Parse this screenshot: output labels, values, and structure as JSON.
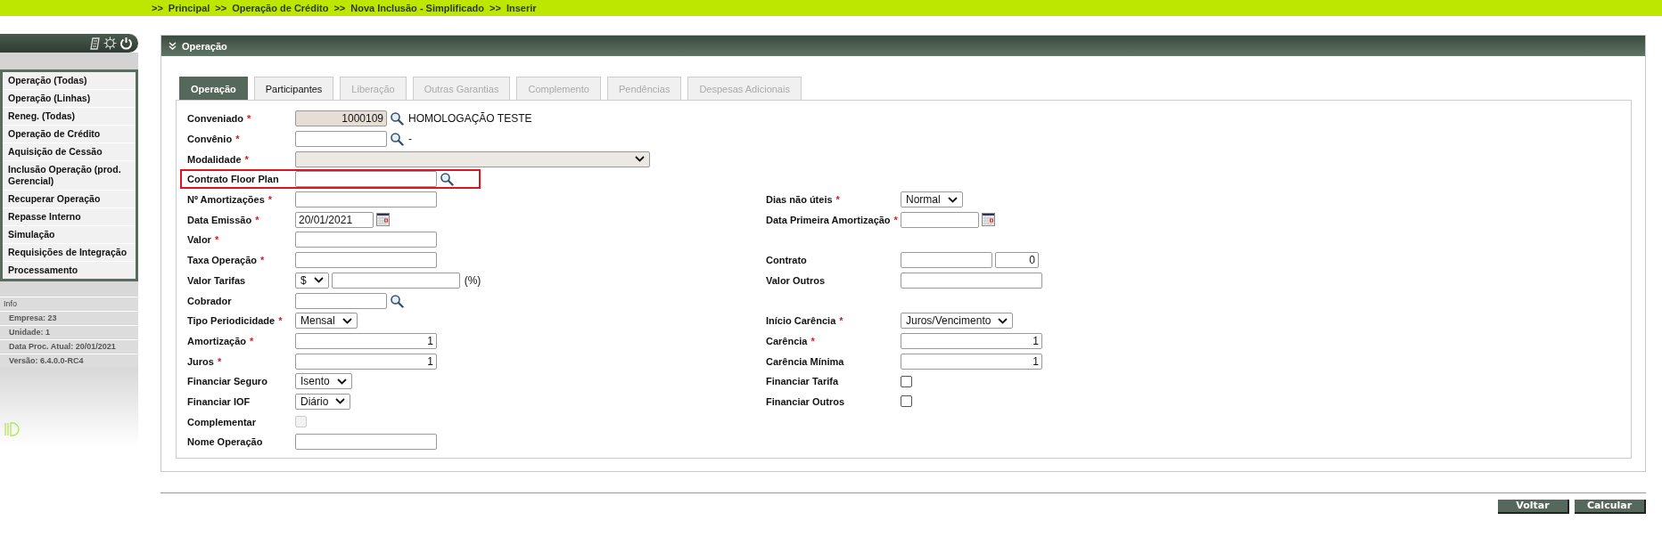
{
  "breadcrumb": [
    {
      "separator": ">>",
      "label": "Principal"
    },
    {
      "separator": ">>",
      "label": "Operação de Crédito"
    },
    {
      "separator": ">>",
      "label": "Nova Inclusão - Simplificado"
    },
    {
      "separator": ">>",
      "label": "Inserir"
    }
  ],
  "sidebar": {
    "menu": [
      "Operação (Todas)",
      "Operação (Linhas)",
      "Reneg. (Todas)",
      "Operação de Crédito",
      "Aquisição de Cessão",
      "Inclusão Operação (prod. Gerencial)",
      "Recuperar Operação",
      "Repasse Interno",
      "Simulação",
      "Requisições de Integração",
      "Processamento"
    ],
    "info_title": "Info",
    "info": [
      "Empresa: 23",
      "Unidade: 1",
      "Data Proc. Atual: 20/01/2021",
      "Versão: 6.4.0.0-RC4"
    ]
  },
  "panel": {
    "title": "Operação"
  },
  "tabs": [
    {
      "label": "Operação",
      "selected": true,
      "disabled": false
    },
    {
      "label": "Participantes",
      "selected": false,
      "disabled": false
    },
    {
      "label": "Liberação",
      "selected": false,
      "disabled": true
    },
    {
      "label": "Outras Garantias",
      "selected": false,
      "disabled": true
    },
    {
      "label": "Complemento",
      "selected": false,
      "disabled": true
    },
    {
      "label": "Pendências",
      "selected": false,
      "disabled": true
    },
    {
      "label": "Despesas Adicionais",
      "selected": false,
      "disabled": true
    }
  ],
  "rows": [
    {
      "left": {
        "label": "Conveniado",
        "required_mark": "*",
        "controls": [
          {
            "kind": "code_input",
            "value": "1000109",
            "readonly": true
          },
          {
            "kind": "search_icon"
          },
          {
            "kind": "text",
            "text": "HOMOLOGAÇÃO TESTE"
          }
        ]
      }
    },
    {
      "left": {
        "label": "Convênio",
        "required_mark": "*",
        "controls": [
          {
            "kind": "code_input"
          },
          {
            "kind": "search_icon"
          },
          {
            "kind": "text",
            "text": "-"
          }
        ]
      }
    },
    {
      "left": {
        "label": "Modalidade",
        "required_mark": "*",
        "controls": [
          {
            "kind": "wide_select",
            "disabled": true
          }
        ]
      }
    },
    {
      "left": {
        "label": "Contrato Floor Plan",
        "highlighted": true,
        "controls": [
          {
            "kind": "input"
          },
          {
            "kind": "search_icon"
          }
        ]
      }
    },
    {
      "left": {
        "label": "Nº Amortizações",
        "required_mark": "*",
        "controls": [
          {
            "kind": "input"
          }
        ]
      },
      "right": {
        "label": "Dias não úteis",
        "required_mark": "*",
        "controls": [
          {
            "kind": "select",
            "value": "Normal"
          }
        ]
      }
    },
    {
      "left": {
        "label": "Data Emissão",
        "required_mark": "*",
        "controls": [
          {
            "kind": "date_input",
            "value": "20/01/2021"
          },
          {
            "kind": "calendar_icon"
          }
        ]
      },
      "right": {
        "label": "Data Primeira Amortização",
        "required_mark": "*",
        "controls": [
          {
            "kind": "date_input"
          },
          {
            "kind": "calendar_icon"
          }
        ]
      }
    },
    {
      "left": {
        "label": "Valor",
        "required_mark": "*",
        "controls": [
          {
            "kind": "input"
          }
        ]
      }
    },
    {
      "left": {
        "label": "Taxa Operação",
        "required_mark": "*",
        "controls": [
          {
            "kind": "input"
          }
        ]
      },
      "right": {
        "label": "Contrato",
        "controls": [
          {
            "kind": "code_input"
          },
          {
            "kind": "tiny_input",
            "value": "0"
          }
        ]
      }
    },
    {
      "left": {
        "label": "Valor Tarifas",
        "controls": [
          {
            "kind": "select",
            "value": "$"
          },
          {
            "kind": "long_input"
          },
          {
            "kind": "text",
            "text": "(%)"
          }
        ]
      },
      "right": {
        "label": "Valor Outros",
        "controls": [
          {
            "kind": "input"
          }
        ]
      }
    },
    {
      "left": {
        "label": "Cobrador",
        "controls": [
          {
            "kind": "code_input"
          },
          {
            "kind": "search_icon"
          }
        ]
      }
    },
    {
      "left": {
        "label": "Tipo Periodicidade",
        "required_mark": "*",
        "controls": [
          {
            "kind": "select",
            "value": "Mensal"
          }
        ]
      },
      "right": {
        "label": "Início Carência",
        "required_mark": "*",
        "controls": [
          {
            "kind": "select",
            "value": "Juros/Vencimento"
          }
        ]
      }
    },
    {
      "left": {
        "label": "Amortização",
        "required_mark": "*",
        "controls": [
          {
            "kind": "number_input",
            "value": "1"
          }
        ]
      },
      "right": {
        "label": "Carência",
        "required_mark": "*",
        "controls": [
          {
            "kind": "number_input",
            "value": "1"
          }
        ]
      }
    },
    {
      "left": {
        "label": "Juros",
        "required_mark": "*",
        "controls": [
          {
            "kind": "number_input",
            "value": "1"
          }
        ]
      },
      "right": {
        "label": "Carência Mínima",
        "controls": [
          {
            "kind": "number_input",
            "value": "1"
          }
        ]
      }
    },
    {
      "left": {
        "label": "Financiar Seguro",
        "controls": [
          {
            "kind": "select",
            "value": "Isento"
          }
        ]
      },
      "right": {
        "label": "Financiar Tarifa",
        "controls": [
          {
            "kind": "checkbox",
            "checked": false,
            "disabled": false
          }
        ]
      }
    },
    {
      "left": {
        "label": "Financiar IOF",
        "controls": [
          {
            "kind": "select",
            "value": "Diário"
          }
        ]
      },
      "right": {
        "label": "Financiar Outros",
        "controls": [
          {
            "kind": "checkbox",
            "checked": false,
            "disabled": false
          }
        ]
      }
    },
    {
      "left": {
        "label": "Complementar",
        "controls": [
          {
            "kind": "checkbox",
            "checked": false,
            "disabled": true
          }
        ]
      }
    },
    {
      "left": {
        "label": "Nome Operação",
        "controls": [
          {
            "kind": "input"
          }
        ]
      }
    }
  ],
  "buttons": [
    "Voltar",
    "Calcular"
  ]
}
